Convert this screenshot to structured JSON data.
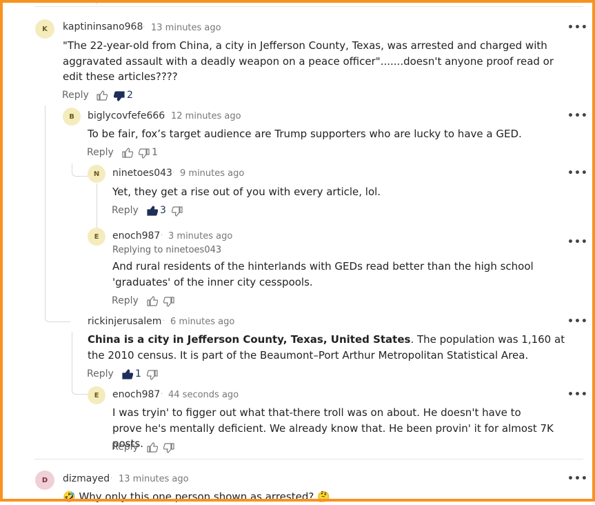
{
  "comments": [
    {
      "avatar": "K",
      "username": "kaptininsano968",
      "time": "13 minutes ago",
      "text": "\"The 22-year-old from China, a city in Jefferson County, Texas, was arrested and charged with aggravated assault with a deadly weapon on a peace officer\".......doesn't anyone proof read or edit these articles????",
      "reply_label": "Reply",
      "likes": "",
      "dislikes": "2"
    },
    {
      "avatar": "B",
      "username": "biglycovfefe666",
      "time": "12 minutes ago",
      "text": "To be fair, fox’s target audience are Trump supporters who are lucky to have a GED.",
      "reply_label": "Reply",
      "likes": "",
      "dislikes": "1"
    },
    {
      "avatar": "N",
      "username": "ninetoes043",
      "time": "9 minutes ago",
      "text": "Yet, they get a rise out of you with every article, lol.",
      "reply_label": "Reply",
      "likes": "3",
      "dislikes": ""
    },
    {
      "avatar": "E",
      "username": "enoch987",
      "time": "3 minutes ago",
      "replying_to": "Replying to ninetoes043",
      "text": "And rural residents of the hinterlands with GEDs read better than the high school 'graduates' of the inner city cesspools.",
      "reply_label": "Reply",
      "likes": "",
      "dislikes": ""
    },
    {
      "username": "rickinjerusalem",
      "time": "6 minutes ago",
      "text_bold": "China is a city in Jefferson County, Texas, United States",
      "text": ". The population was 1,160 at the 2010 census. It is part of the Beaumont–Port Arthur Metropolitan Statistical Area.",
      "reply_label": "Reply",
      "likes": "1",
      "dislikes": ""
    },
    {
      "avatar": "E",
      "username": "enoch987",
      "time": "44 seconds ago",
      "text": "I was tryin' to figger out what that-there troll was on about.  He doesn't have to prove he's mentally deficient.  We already know that.  He been provin' it for almost 7K posts.",
      "reply_label": "Reply",
      "likes": "",
      "dislikes": ""
    },
    {
      "avatar": "D",
      "username": "dizmayed",
      "time": "13 minutes ago",
      "text": "🤣 Why only this one person shown as arrested? 🤔"
    }
  ],
  "separator_dot": "·",
  "more_label": "•••",
  "icons": {
    "like": "thumbs-up-icon",
    "dislike": "thumbs-down-icon",
    "more": "more-options-icon"
  },
  "colors": {
    "frame": "#f7931e",
    "avatar_yellow": "#f4ecbd",
    "avatar_pink": "#f1cfd6",
    "active_vote": "#1f2f5a"
  }
}
